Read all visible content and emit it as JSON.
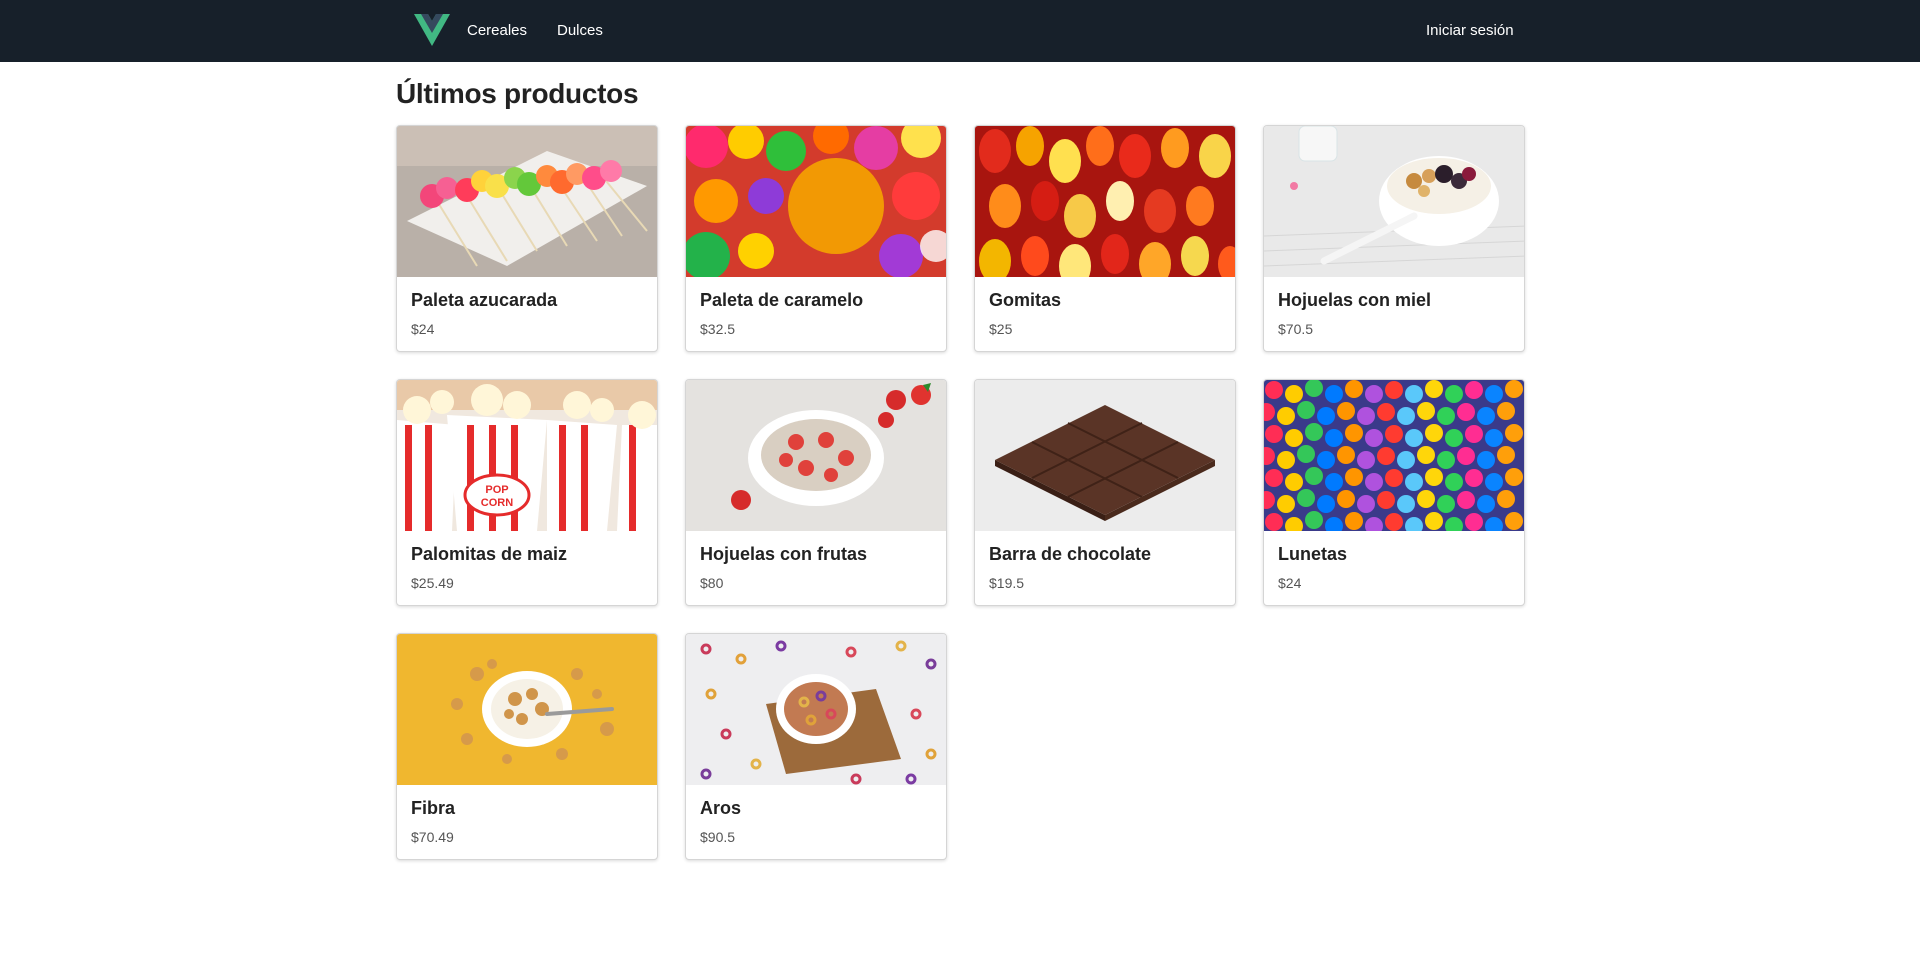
{
  "nav": {
    "links": [
      "Cereales",
      "Dulces"
    ],
    "login": "Iniciar sesión",
    "brand_color": "#41b883",
    "brand_dark": "#35495e",
    "bg": "#17202a"
  },
  "page": {
    "title": "Últimos productos"
  },
  "products": [
    {
      "name": "Paleta azucarada",
      "price": "$24",
      "image": "lollipops-image"
    },
    {
      "name": "Paleta de caramelo",
      "price": "$32.5",
      "image": "caramel-candies-image"
    },
    {
      "name": "Gomitas",
      "price": "$25",
      "image": "gummy-bears-image"
    },
    {
      "name": "Hojuelas con miel",
      "price": "$70.5",
      "image": "honey-flakes-bowl-image"
    },
    {
      "name": "Palomitas de maiz",
      "price": "$25.49",
      "image": "popcorn-image"
    },
    {
      "name": "Hojuelas con frutas",
      "price": "$80",
      "image": "fruit-flakes-bowl-image"
    },
    {
      "name": "Barra de chocolate",
      "price": "$19.5",
      "image": "chocolate-bar-image"
    },
    {
      "name": "Lunetas",
      "price": "$24",
      "image": "candy-buttons-image"
    },
    {
      "name": "Fibra",
      "price": "$70.49",
      "image": "fiber-cereal-image"
    },
    {
      "name": "Aros",
      "price": "$90.5",
      "image": "cereal-rings-image"
    }
  ]
}
